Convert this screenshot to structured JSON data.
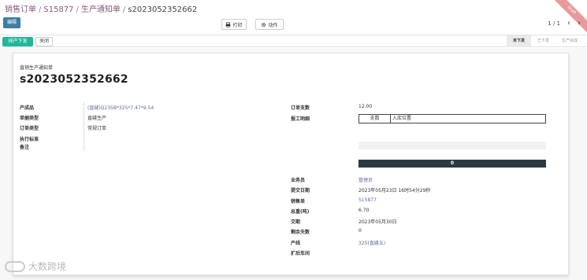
{
  "breadcrumb": {
    "items": [
      "销售订单",
      "S15877",
      "生产通知单"
    ],
    "current": "s2023052352662"
  },
  "ribbon": {
    "text": "Draft"
  },
  "toolbar": {
    "edit_label": "编辑",
    "print_label": "打印",
    "action_label": "动作"
  },
  "pager": {
    "value": "1 / 1"
  },
  "statusbar": {
    "primary_label": "排产下发",
    "close_label": "关闭",
    "stages": [
      "未下发",
      "已下发",
      "生产完成"
    ],
    "active_stage": "未下发"
  },
  "form": {
    "doc_type": "直销生产通知单",
    "doc_name": "s2023052352662",
    "left_fields": [
      {
        "label": "产成品",
        "value": "(直缝)Q235B*325*7.47*9.54",
        "link": true
      },
      {
        "label": "单据类型",
        "value": "直缝生产",
        "link": false
      },
      {
        "label": "订单类型",
        "value": "常规订单",
        "link": false
      },
      {
        "label": "执行标准",
        "value": "",
        "link": false
      },
      {
        "label": "备注",
        "value": "",
        "link": false
      }
    ],
    "order_qty": {
      "label": "订单支数",
      "value": "12.00"
    },
    "report_detail": {
      "label": "报工明细",
      "columns": [
        "支数",
        "入库位置"
      ]
    },
    "progress_value": "0",
    "right_fields": [
      {
        "label": "业务员",
        "value": "管理员",
        "link": true
      },
      {
        "label": "提交日期",
        "value": "2023年05月23日 16时54分29秒",
        "link": false
      },
      {
        "label": "销售单",
        "value": "S15877",
        "link": false
      },
      {
        "label": "总重(吨)",
        "value": "6.70",
        "link": false
      },
      {
        "label": "交期",
        "value": "2023年05月30日",
        "link": false
      },
      {
        "label": "剩余天数",
        "value": "0",
        "link": false
      },
      {
        "label": "产线",
        "value": "325(直缝五)",
        "link": true
      },
      {
        "label": "扩后车间",
        "value": "",
        "link": false
      }
    ]
  },
  "watermark": {
    "text": "大数跨境"
  },
  "colors": {
    "edit": "#3e7ea4",
    "primary": "#21b799",
    "link": "#5a6e93",
    "dark_bar": "#2b3a42",
    "ribbon": "#e79a9a"
  }
}
